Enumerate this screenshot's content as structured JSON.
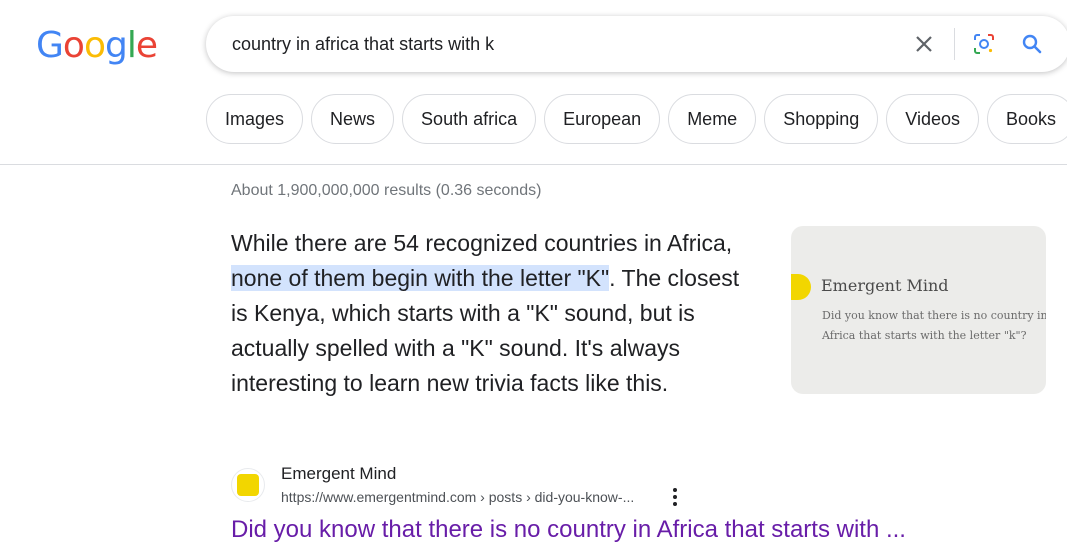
{
  "logo": "Google",
  "search": {
    "query": "country in africa that starts with k"
  },
  "chips": [
    "Images",
    "News",
    "South africa",
    "European",
    "Meme",
    "Shopping",
    "Videos",
    "Books"
  ],
  "stats": "About 1,900,000,000 results (0.36 seconds)",
  "answer": {
    "before": "While there are 54 recognized countries in Africa, ",
    "highlight": "none of them begin with the letter \"K\"",
    "after": ". The closest is Kenya, which starts with a \"K\" sound, but is actually spelled with a \"K\" sound. It's always interesting to learn new trivia facts like this."
  },
  "thumbnail": {
    "brand": "Emergent Mind",
    "caption_line1": "Did you know that there is no country in",
    "caption_line2": "Africa that starts with the letter \"k\"?"
  },
  "source": {
    "name": "Emergent Mind",
    "url": "https://www.emergentmind.com › posts › did-you-know-...",
    "title": "Did you know that there is no country in Africa that starts with ..."
  },
  "colors": {
    "blue": "#4285F4",
    "red": "#EA4335",
    "yellow": "#FBBC05",
    "green": "#34A853",
    "visited_link": "#681da8",
    "highlight": "#d3e3fd"
  }
}
